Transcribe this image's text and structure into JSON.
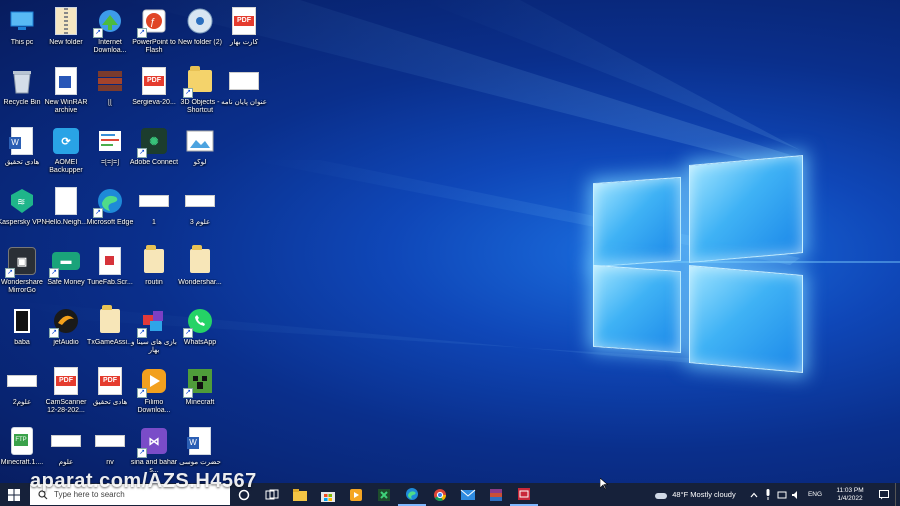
{
  "desktop": {
    "icons": [
      {
        "label": "This pc",
        "icon": "computer-icon"
      },
      {
        "label": "New folder",
        "icon": "zip-folder-icon"
      },
      {
        "label": "Internet Downloa...",
        "icon": "idm-icon"
      },
      {
        "label": "PowerPoint to Flash",
        "icon": "ppt-flash-icon"
      },
      {
        "label": "New folder (2)",
        "icon": "disc-icon"
      },
      {
        "label": "کارت بهار",
        "icon": "pdf-icon"
      },
      {
        "label": "Recycle Bin",
        "icon": "recycle-bin-icon"
      },
      {
        "label": "New WinRAR archive",
        "icon": "winrar-icon"
      },
      {
        "label": "[[",
        "icon": "archive-stack-icon"
      },
      {
        "label": "Sergieva-20...",
        "icon": "pdf-icon"
      },
      {
        "label": "3D Objects - Shortcut",
        "icon": "folder-shortcut-icon"
      },
      {
        "label": "عنوان پایان نامه",
        "icon": "document-image-icon"
      },
      {
        "label": "هادی تحقیق",
        "icon": "word-doc-icon"
      },
      {
        "label": "AOMEI Backupper",
        "icon": "aomei-icon"
      },
      {
        "label": "=[=]=]",
        "icon": "text-file-icon"
      },
      {
        "label": "Adobe Connect",
        "icon": "adobe-connect-icon"
      },
      {
        "label": "لوگو",
        "icon": "image-icon"
      },
      {
        "label": "Kaspersky VPN",
        "icon": "kaspersky-icon"
      },
      {
        "label": "Hello.Neigh...",
        "icon": "blank-file-icon"
      },
      {
        "label": "Microsoft Edge",
        "icon": "edge-icon"
      },
      {
        "label": "1",
        "icon": "banner-image-icon"
      },
      {
        "label": "علوم 3",
        "icon": "banner-image-icon"
      },
      {
        "label": "Wondershare MirrorGo",
        "icon": "mirrorgo-icon"
      },
      {
        "label": "Safe Money",
        "icon": "safe-money-icon"
      },
      {
        "label": "TuneFab.Scr...",
        "icon": "tunefab-icon"
      },
      {
        "label": "routin",
        "icon": "folder-icon"
      },
      {
        "label": "Wondershar...",
        "icon": "folder-icon"
      },
      {
        "label": "baba",
        "icon": "door-icon"
      },
      {
        "label": "jetAudio",
        "icon": "jetaudio-icon"
      },
      {
        "label": "TxGameAssi...",
        "icon": "folder-icon"
      },
      {
        "label": "بازی های سینا و بهار",
        "icon": "games-icon"
      },
      {
        "label": "WhatsApp",
        "icon": "whatsapp-icon"
      },
      {
        "label": "علوم2",
        "icon": "banner-image-icon"
      },
      {
        "label": "CamScanner 12-28-202...",
        "icon": "pdf-icon"
      },
      {
        "label": "هادی تحقیق",
        "icon": "pdf-icon"
      },
      {
        "label": "Filimo Downloa...",
        "icon": "filimo-icon"
      },
      {
        "label": "Minecraft",
        "icon": "minecraft-icon"
      },
      {
        "label": "Minecraft.1....",
        "icon": "ftp-icon"
      },
      {
        "label": "علوم",
        "icon": "banner-image-icon"
      },
      {
        "label": "nv",
        "icon": "banner-image-icon"
      },
      {
        "label": "sina and bahar s...",
        "icon": "visual-studio-icon"
      },
      {
        "label": "حضرت موسی",
        "icon": "word-doc-icon"
      }
    ]
  },
  "watermark": "aparat.com/AZS.H4567",
  "taskbar": {
    "search_placeholder": "Type here to search",
    "weather": "48°F  Mostly cloudy",
    "language": "ENG",
    "time": "11:03 PM",
    "date": "1/4/2022",
    "pinned": [
      "task-view-icon",
      "file-explorer-icon",
      "store-icon",
      "media-player-icon",
      "camtasia-icon",
      "edge-icon",
      "chrome-icon",
      "mail-icon",
      "winrar-icon",
      "app-red-icon"
    ]
  },
  "colors": {
    "accent": "#0a49d1",
    "taskbar": "#16213a",
    "logo": "#3fb2f5"
  }
}
